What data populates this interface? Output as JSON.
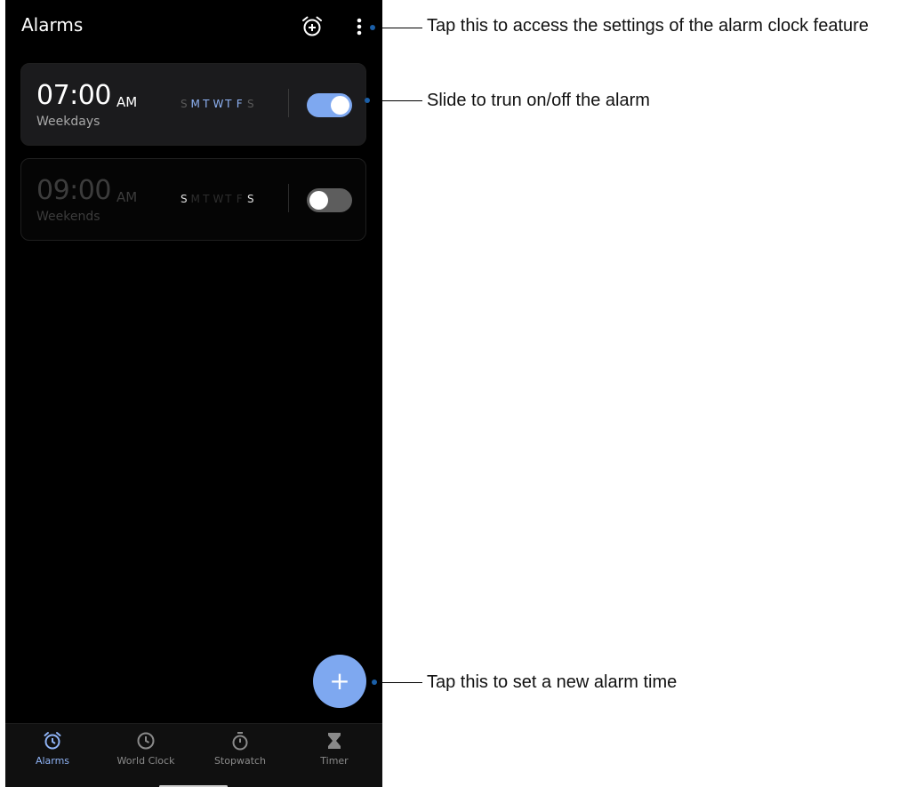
{
  "appbar": {
    "title": "Alarms",
    "add_alarm_icon": "alarm-add-icon",
    "more_icon": "more-vert-icon"
  },
  "alarms": [
    {
      "time": "07:00",
      "period": "AM",
      "label": "Weekdays",
      "days": [
        "S",
        "M",
        "T",
        "W",
        "T",
        "F",
        "S"
      ],
      "active_days": [
        false,
        true,
        true,
        true,
        true,
        true,
        false
      ],
      "enabled": true
    },
    {
      "time": "09:00",
      "period": "AM",
      "label": "Weekends",
      "days": [
        "S",
        "M",
        "T",
        "W",
        "T",
        "F",
        "S"
      ],
      "active_days": [
        true,
        false,
        false,
        false,
        false,
        false,
        true
      ],
      "enabled": false
    }
  ],
  "fab": {
    "icon": "plus-icon",
    "glyph": "+"
  },
  "nav": {
    "items": [
      {
        "label": "Alarms",
        "icon": "alarm-clock-icon",
        "active": true
      },
      {
        "label": "World Clock",
        "icon": "clock-icon",
        "active": false
      },
      {
        "label": "Stopwatch",
        "icon": "stopwatch-icon",
        "active": false
      },
      {
        "label": "Timer",
        "icon": "hourglass-icon",
        "active": false
      }
    ]
  },
  "callouts": {
    "settings": "Tap this to access the settings of the alarm clock feature",
    "toggle": "Slide to trun on/off the alarm",
    "new_alarm": "Tap this to set a new alarm time"
  },
  "colors": {
    "accent": "#7ea8f0",
    "active_day": "#8fb3f5",
    "background": "#000000",
    "card": "#1b1b1d",
    "callout_dot": "#1b5fa8"
  }
}
